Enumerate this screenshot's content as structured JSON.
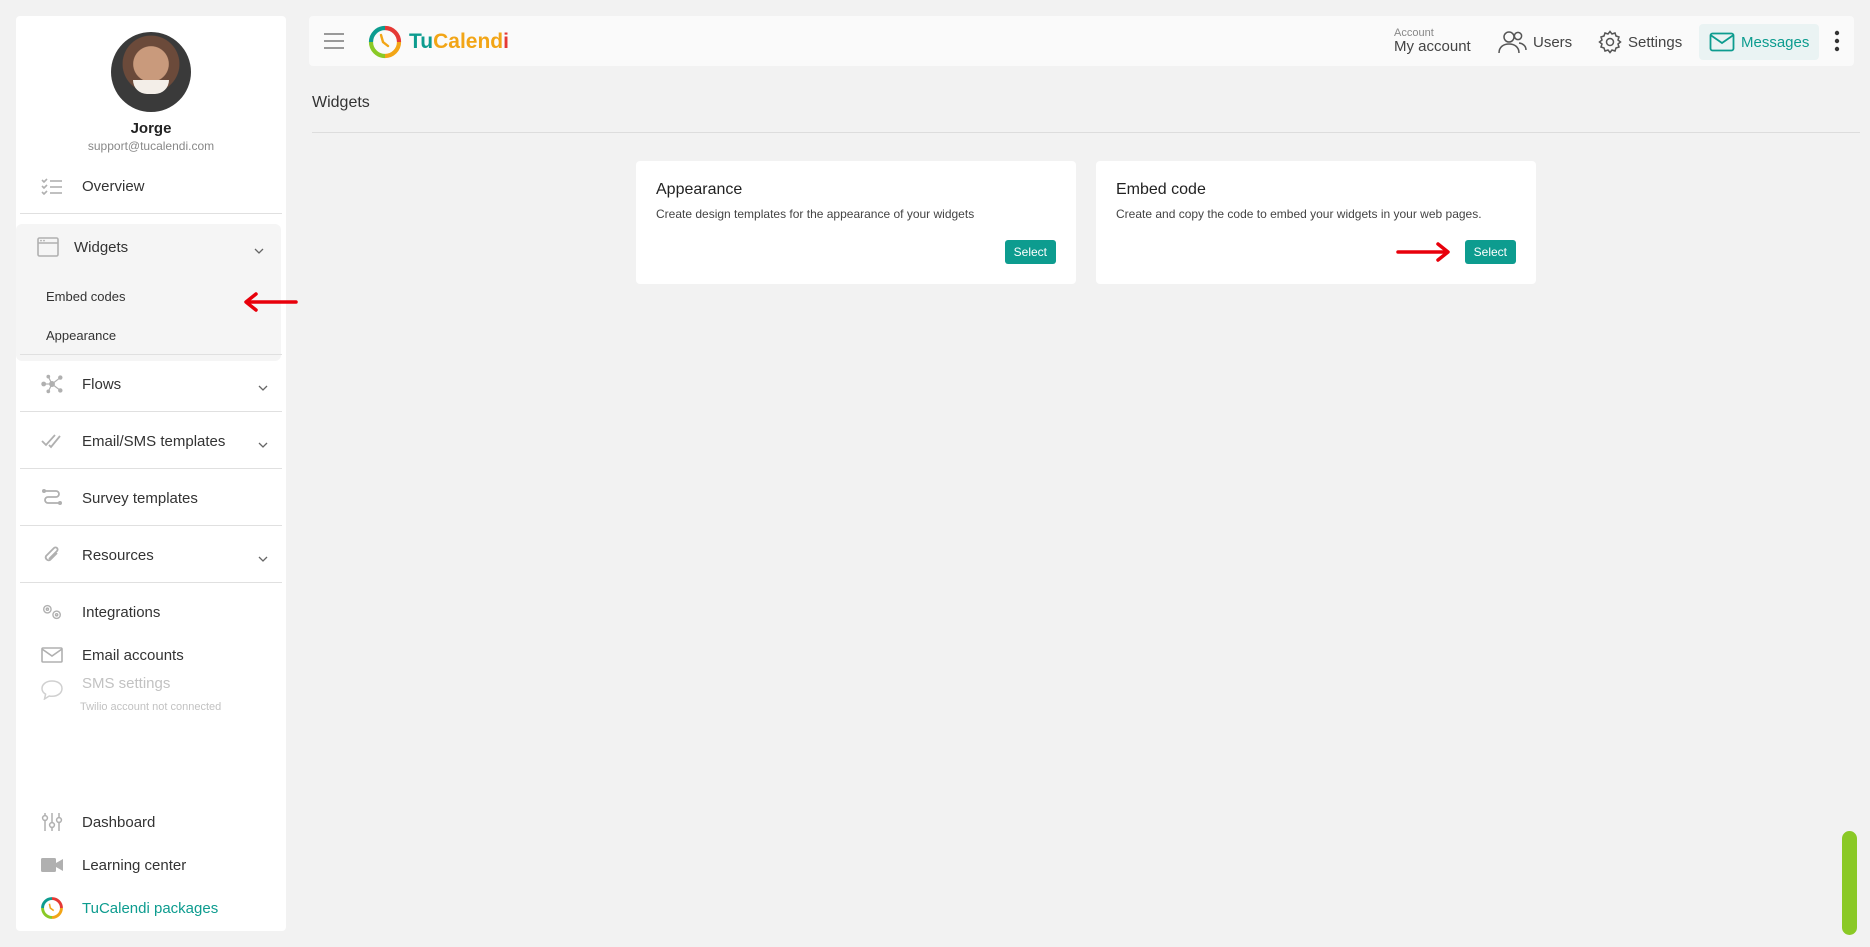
{
  "app": {
    "logo_text_tu": "Tu",
    "logo_text_calend": "Calend",
    "logo_text_i": "i",
    "brand_colors": {
      "teal": "#0d9c8f",
      "orange": "#f2a516",
      "red": "#e53935",
      "green": "#8ac926"
    }
  },
  "profile": {
    "name": "Jorge",
    "email": "support@tucalendi.com"
  },
  "sidebar": {
    "overview": "Overview",
    "widgets": "Widgets",
    "embed_codes": "Embed codes",
    "appearance": "Appearance",
    "flows": "Flows",
    "email_sms_templates": "Email/SMS templates",
    "survey_templates": "Survey templates",
    "resources": "Resources",
    "integrations": "Integrations",
    "email_accounts": "Email accounts",
    "sms_settings": "SMS settings",
    "sms_sub": "Twilio account not connected",
    "dashboard": "Dashboard",
    "learning_center": "Learning center",
    "packages": "TuCalendi packages"
  },
  "topbar": {
    "account_small": "Account",
    "account_big": "My account",
    "users": "Users",
    "settings": "Settings",
    "messages": "Messages"
  },
  "page": {
    "title": "Widgets",
    "cards": [
      {
        "title": "Appearance",
        "desc": "Create design templates for the appearance of your widgets",
        "button": "Select"
      },
      {
        "title": "Embed code",
        "desc": "Create and copy the code to embed your widgets in your web pages.",
        "button": "Select"
      }
    ]
  }
}
